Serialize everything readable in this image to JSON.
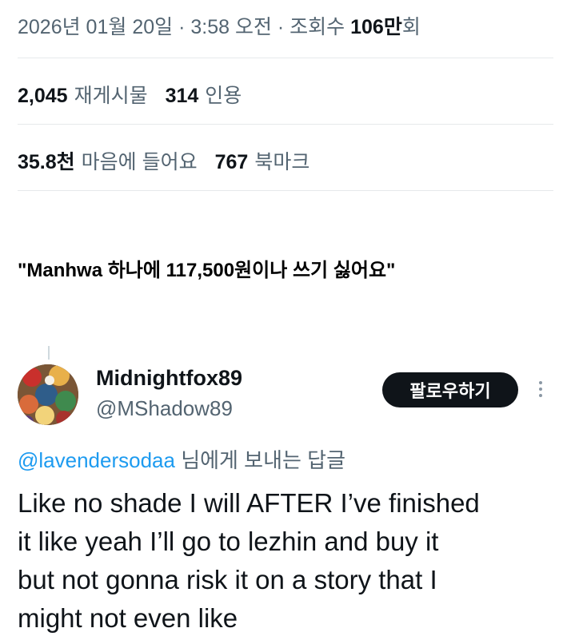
{
  "meta": {
    "datetime": "2026년 01월 20일 · 3:58 오전 · 조회수 ",
    "views_count": "106만",
    "views_suffix": "회"
  },
  "stats_row1": {
    "reposts_count": "2,045",
    "reposts_label": "재게시물",
    "quotes_count": "314",
    "quotes_label": "인용"
  },
  "stats_row2": {
    "likes_count": "35.8천",
    "likes_label": "마음에 들어요",
    "bookmarks_count": "767",
    "bookmarks_label": "북마크"
  },
  "caption": "\"Manhwa 하나에 117,500원이나 쓰기 싫어요\"",
  "reply": {
    "display_name": "Midnightfox89",
    "handle": "@MShadow89",
    "follow_label": "팔로우하기",
    "reply_to_handle": "@lavendersodaa",
    "reply_to_suffix": " 님에게 보내는 답글",
    "text_lines": [
      "Like no shade I will AFTER I’ve finished",
      "it like yeah I’ll go to lezhin and buy it",
      "but not gonna risk it on a story that I",
      "might not even like"
    ]
  },
  "colors": {
    "accent": "#1d9bf0",
    "muted": "#536471",
    "primary_text": "#0f1419",
    "button_bg": "#0f1419"
  }
}
